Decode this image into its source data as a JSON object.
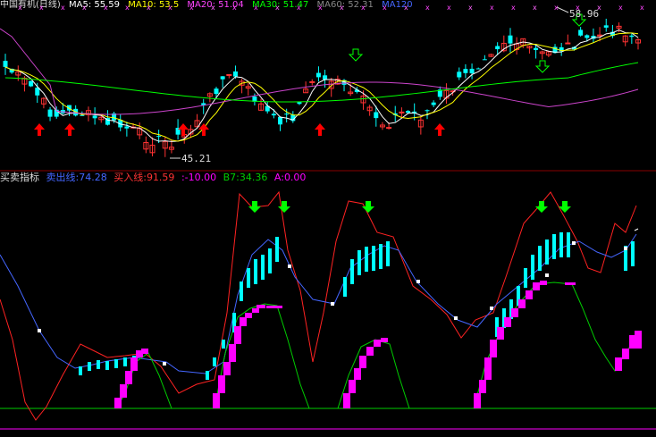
{
  "header": {
    "title": "中国有机(日线)",
    "ma_items": [
      {
        "label": "MA5: 55.59",
        "color": "#ffffff"
      },
      {
        "label": "MA10: 53.5",
        "color": "#ffff00"
      },
      {
        "label": "MA20: 51.04",
        "color": "#ff44ff"
      },
      {
        "label": "MA30: 51.47",
        "color": "#00ff00"
      },
      {
        "label": "MA60: 52.31",
        "color": "#888888"
      },
      {
        "label": "MA120",
        "color": "#4466ff"
      }
    ]
  },
  "price_labels": {
    "high": "58.96",
    "low": "45.21"
  },
  "indicator": {
    "name": "买卖指标",
    "sell_line_label": "卖出线:",
    "sell_line_value": "74.28",
    "buy_line_label": "买入线:",
    "buy_line_value": "91.59",
    "neg_label": ":",
    "neg_value": "-10.00",
    "b7_label": "B7:",
    "b7_value": "34.36",
    "a_label": "A:",
    "a_value": "0.00"
  },
  "colors": {
    "up": "#ff3333",
    "down": "#00ffff",
    "ma5": "#ffffff",
    "ma10": "#ffff00",
    "ma20": "#cc44cc",
    "ma30": "#00ff00",
    "sell_line": "#4466ff",
    "buy_line": "#ff2222",
    "magenta": "#ff00ff",
    "green_line": "#00cc00",
    "arrow_up": "#ff0000",
    "arrow_down": "#00ff00",
    "cyan_bar": "#00ffff"
  },
  "chart_data": {
    "type": "candlestick",
    "series": [
      {
        "name": "MA5"
      },
      {
        "name": "MA10"
      },
      {
        "name": "MA20"
      },
      {
        "name": "MA30"
      },
      {
        "name": "卖出线"
      },
      {
        "name": "买入线"
      },
      {
        "name": "B7"
      }
    ]
  }
}
